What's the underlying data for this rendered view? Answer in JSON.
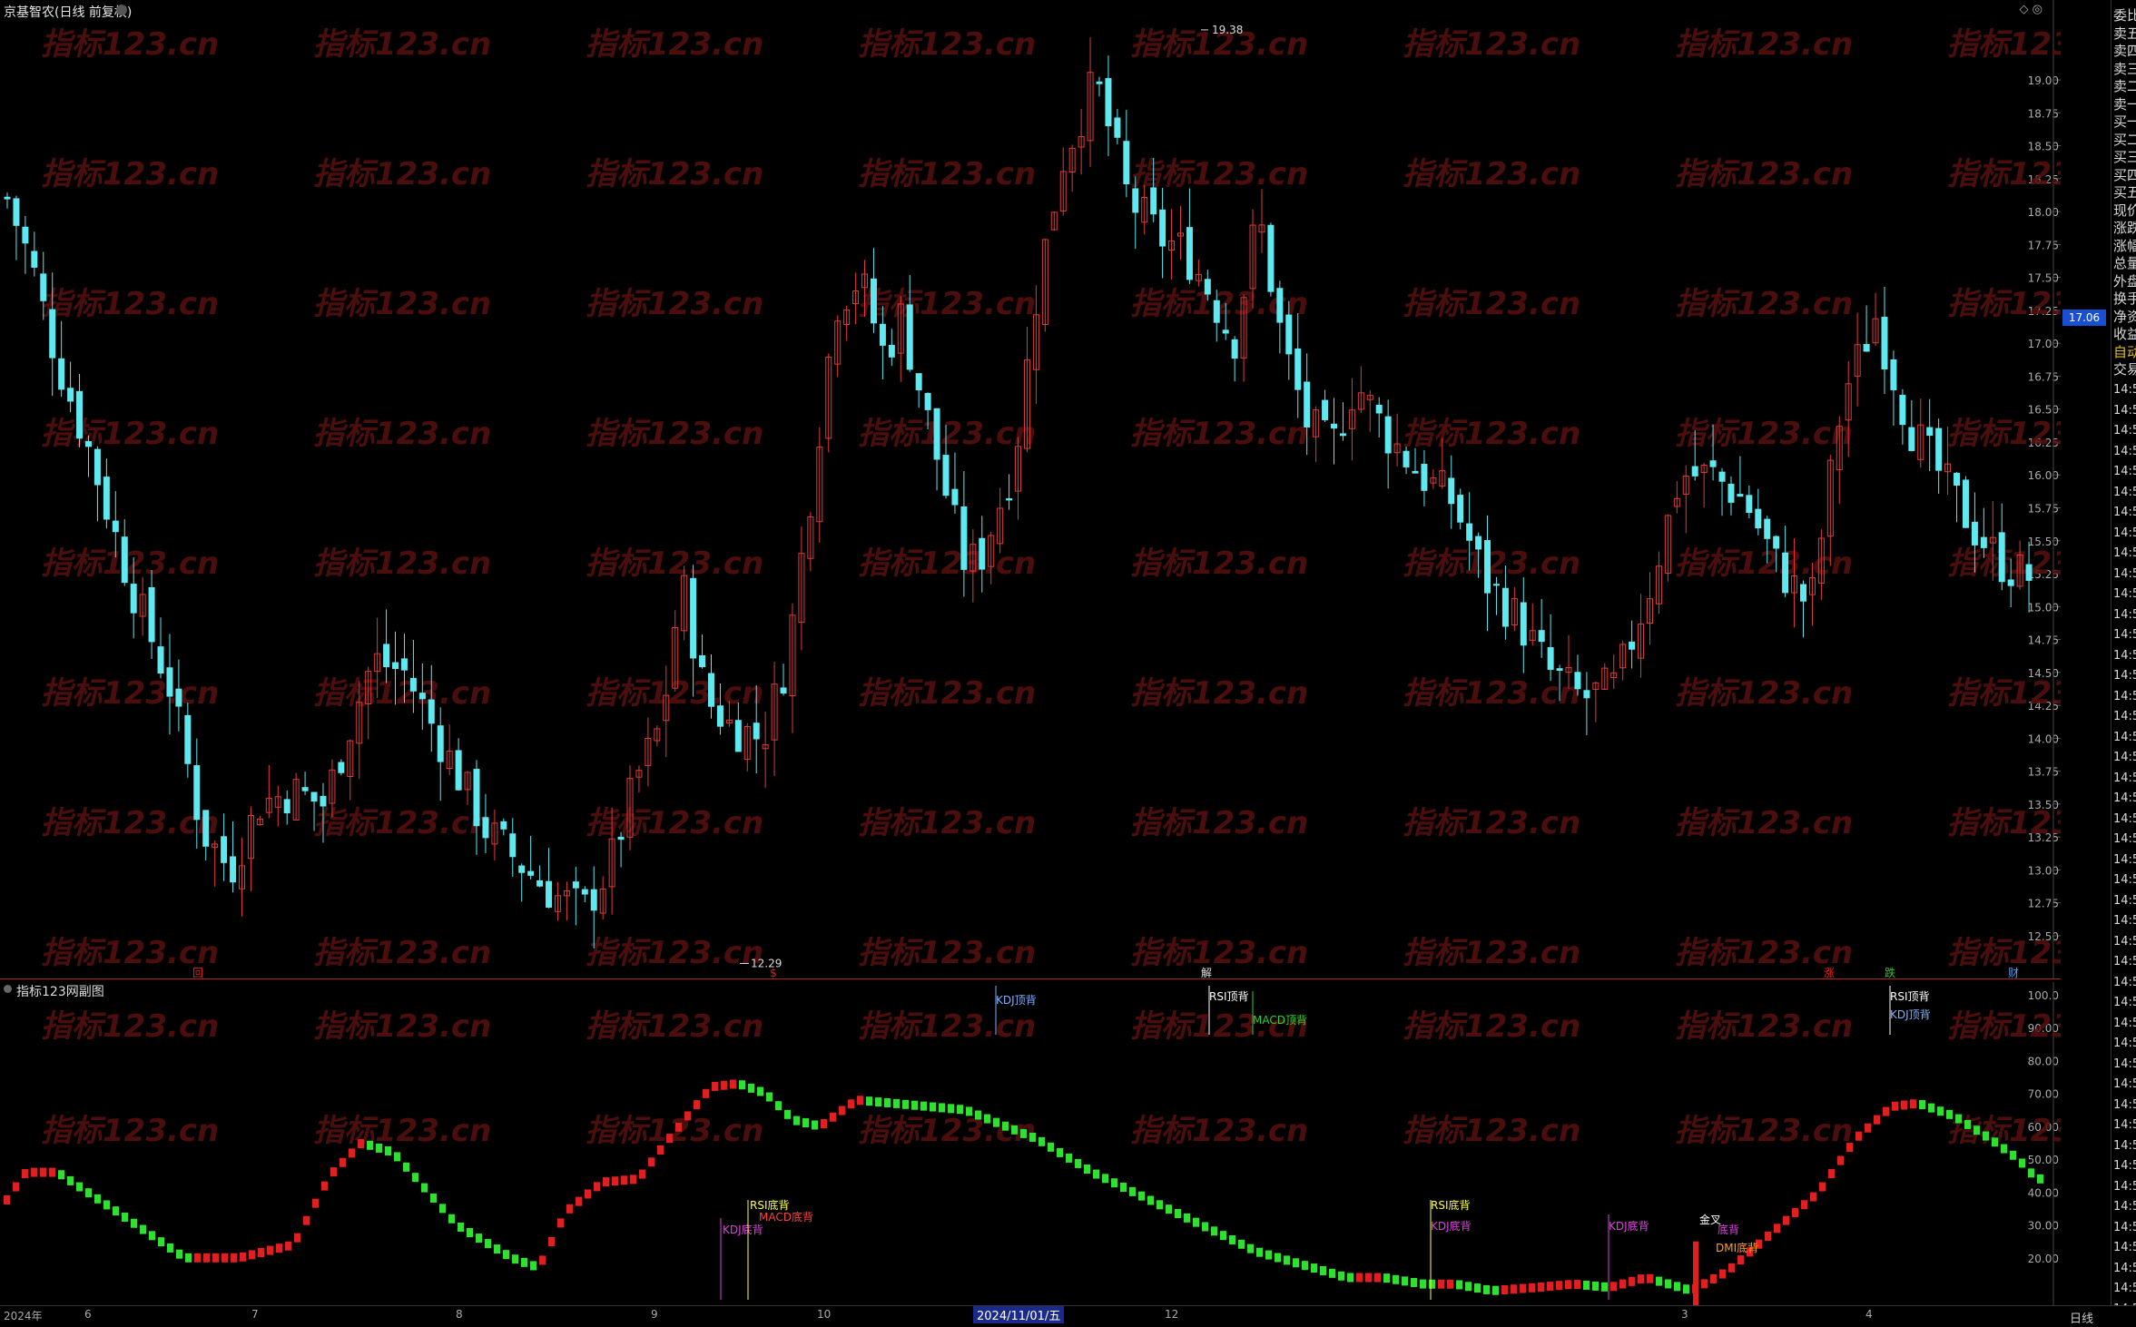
{
  "header": {
    "stock_title": "京基智农(日线 前复权)",
    "top_right_icons": "◇ ◎"
  },
  "main_chart": {
    "price_axis": [
      "19.00",
      "18.75",
      "18.50",
      "18.25",
      "18.00",
      "17.75",
      "17.50",
      "17.25",
      "17.00",
      "16.75",
      "16.50",
      "16.25",
      "16.00",
      "15.75",
      "15.50",
      "15.25",
      "15.00",
      "14.75",
      "14.50",
      "14.25",
      "14.00",
      "13.75",
      "13.50",
      "13.25",
      "13.00",
      "12.75",
      "12.50"
    ],
    "price_min": 12.29,
    "price_max": 19.38,
    "high_label": "19.38",
    "low_label": "12.29",
    "current_price": "17.06",
    "watermark": "指标123.cn",
    "event_markers": [
      {
        "label": "回",
        "color": "#e02020"
      },
      {
        "label": "$",
        "color": "#e02020"
      },
      {
        "label": "解",
        "color": "#e0e0e0"
      },
      {
        "label": "涨",
        "color": "#e02020"
      },
      {
        "label": "跌",
        "color": "#30c030"
      },
      {
        "label": "财",
        "color": "#40a0ff"
      }
    ]
  },
  "indicator": {
    "title": "指标123网副图",
    "axis": [
      "100.0",
      "90.00",
      "80.00",
      "70.00",
      "60.00",
      "50.00",
      "40.00",
      "30.00",
      "20.00"
    ],
    "signals": [
      {
        "text": "KDJ顶背",
        "color": "#7fb0ff"
      },
      {
        "text": "RSI顶背",
        "color": "#ffffff"
      },
      {
        "text": "MACD顶背",
        "color": "#30d030"
      },
      {
        "text": "RSI顶背",
        "color": "#ffffff"
      },
      {
        "text": "KDJ顶背",
        "color": "#7fb0ff"
      },
      {
        "text": "RSI底背",
        "color": "#ffff40"
      },
      {
        "text": "MACD底背",
        "color": "#ff4040"
      },
      {
        "text": "KDJ底背",
        "color": "#e040e0"
      },
      {
        "text": "RSI底背",
        "color": "#ffff40"
      },
      {
        "text": "KDJ底背",
        "color": "#e040e0"
      },
      {
        "text": "KDJ底背",
        "color": "#e040e0"
      },
      {
        "text": "金叉",
        "color": "#ffffff"
      },
      {
        "text": "底背",
        "color": "#e040e0"
      },
      {
        "text": "DMI底背",
        "color": "#ffa020"
      }
    ]
  },
  "time_axis": {
    "labels": [
      "2024年",
      "6",
      "7",
      "8",
      "9",
      "10",
      "12",
      "3",
      "4"
    ],
    "current_date": "2024/11/01/五",
    "period": "日线"
  },
  "quote_panel": {
    "items": [
      "委比",
      "卖五",
      "卖四",
      "卖三",
      "卖二",
      "卖一",
      "买一",
      "买二",
      "买三",
      "买四",
      "买五",
      "现价",
      "涨跌",
      "涨幅",
      "总量",
      "外盘",
      "换手",
      "净资",
      "收益",
      "自动",
      "交易"
    ],
    "time_entries": "14:5"
  },
  "colors": {
    "up": "#e03a3a",
    "down": "#5ee8f0",
    "indicator_up": "#e02020",
    "indicator_down": "#30e030",
    "watermark": "#5a1010"
  }
}
